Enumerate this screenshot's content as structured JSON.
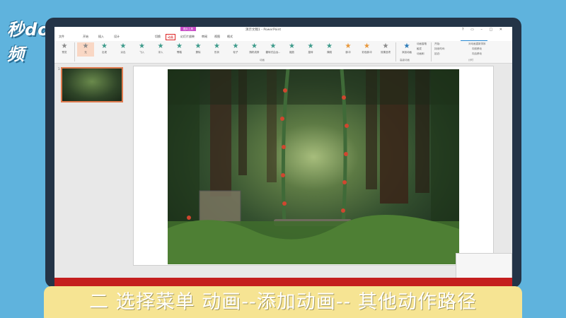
{
  "brand": {
    "logo_text": "秒dong视频"
  },
  "window": {
    "title": "演示文稿1 - PowerPoint",
    "context_tab": "图片工具",
    "controls": "? ▭ – □ ✕"
  },
  "tabs": [
    {
      "label": "文件"
    },
    {
      "label": "开始"
    },
    {
      "label": "插入"
    },
    {
      "label": "设计"
    },
    {
      "label": "切换"
    },
    {
      "label": "动画"
    },
    {
      "label": "幻灯片放映"
    },
    {
      "label": "审阅"
    },
    {
      "label": "视图"
    },
    {
      "label": "格式"
    }
  ],
  "share": {
    "label": "共享"
  },
  "user": {
    "label": "登录"
  },
  "ribbon": {
    "preview_label": "预览",
    "effects": [
      {
        "label": "无"
      },
      {
        "label": "出现"
      },
      {
        "label": "淡出"
      },
      {
        "label": "飞入"
      },
      {
        "label": "浮入"
      },
      {
        "label": "劈裂"
      },
      {
        "label": "擦除"
      },
      {
        "label": "形状"
      },
      {
        "label": "轮子"
      },
      {
        "label": "随机线条"
      },
      {
        "label": "翻转式由远..."
      },
      {
        "label": "缩放"
      },
      {
        "label": "旋转"
      },
      {
        "label": "弹跳"
      },
      {
        "label": "脉冲"
      },
      {
        "label": "彩色脉冲"
      }
    ],
    "effect_options": "效果选项",
    "add_animation": "添加动画",
    "animation_pane": "动画窗格",
    "trigger": "触发",
    "animation_painter": "动画刷",
    "group_animation": "动画",
    "group_advanced": "高级动画",
    "group_timing": "计时",
    "timing": {
      "start": "开始:",
      "duration": "持续时间:",
      "delay": "延迟:",
      "reorder": "对动画重新排序",
      "earlier": "向前移动",
      "later": "向后移动"
    }
  },
  "slide": {
    "number": "1"
  },
  "caption": {
    "text": "二  选择菜单 动画--添加动画-- 其他动作路径"
  }
}
